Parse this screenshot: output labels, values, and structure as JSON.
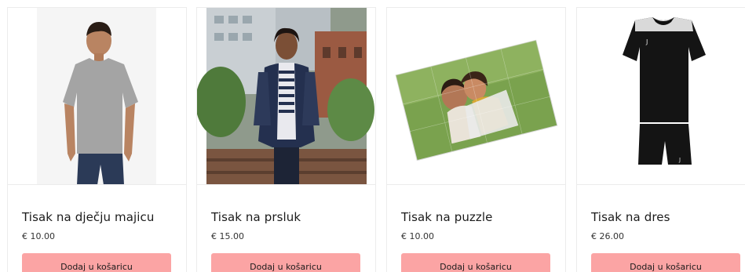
{
  "products": [
    {
      "title": "Tisak na dječju majicu",
      "price": "€ 10.00",
      "button_label": "Dodaj u košaricu",
      "image": "kids-grey-tshirt"
    },
    {
      "title": "Tisak na prsluk",
      "price": "€ 15.00",
      "button_label": "Dodaj u košaricu",
      "image": "woman-navy-vest"
    },
    {
      "title": "Tisak na puzzle",
      "price": "€ 10.00",
      "button_label": "Dodaj u košaricu",
      "image": "photo-puzzle"
    },
    {
      "title": "Tisak na dres",
      "price": "€ 26.00",
      "button_label": "Dodaj u košaricu",
      "image": "black-sports-kit"
    }
  ],
  "colors": {
    "button_bg": "#fba4a4",
    "border": "#ececec",
    "text": "#1b1b1b"
  }
}
